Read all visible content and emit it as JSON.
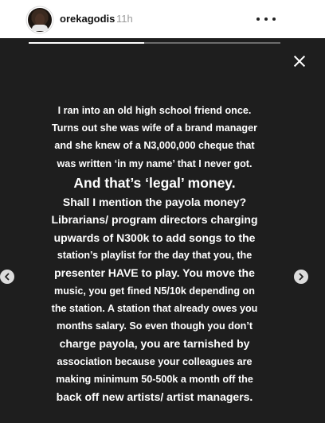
{
  "header": {
    "username": "orekagodis",
    "time_ago": "11h"
  },
  "story": {
    "progress_fraction": 0.46,
    "lines": [
      {
        "text": "I ran into an old high school friend once.",
        "size": "normal"
      },
      {
        "text": "Turns out she was wife of a brand manager",
        "size": "normal"
      },
      {
        "text": "and she knew of  a N3,000,000 cheque that",
        "size": "normal"
      },
      {
        "text": "was written ‘in my name’ that I never got.",
        "size": "normal"
      },
      {
        "text": "And that’s ‘legal’ money.",
        "size": "big"
      },
      {
        "text": "Shall I mention the payola money?",
        "size": "mid"
      },
      {
        "text": "Librarians/ program directors charging",
        "size": "mid"
      },
      {
        "text": "upwards of N300k to add songs to the",
        "size": "mid"
      },
      {
        "text": "station’s playlist for the day that you, the",
        "size": "normal"
      },
      {
        "text": "presenter HAVE to play. You move the",
        "size": "mid"
      },
      {
        "text": "music, you get fined N5/10k depending on",
        "size": "normal"
      },
      {
        "text": "the station. A station that already owes you",
        "size": "normal"
      },
      {
        "text": "months salary. So even though you don’t",
        "size": "normal"
      },
      {
        "text": "charge payola, you are tarnished by",
        "size": "mid"
      },
      {
        "text": "association because your colleagues are",
        "size": "normal"
      },
      {
        "text": "making minimum 50-500k a month off the",
        "size": "normal"
      },
      {
        "text": "back off new artists/ artist managers.",
        "size": "mid"
      }
    ]
  },
  "icons": {
    "more": "more-horizontal-icon",
    "close": "close-icon",
    "prev": "chevron-left-icon",
    "next": "chevron-right-icon"
  },
  "colors": {
    "story_bg": "#1e1e1e",
    "text": "#ffffff",
    "nav_bg": "#dcdcdc"
  }
}
